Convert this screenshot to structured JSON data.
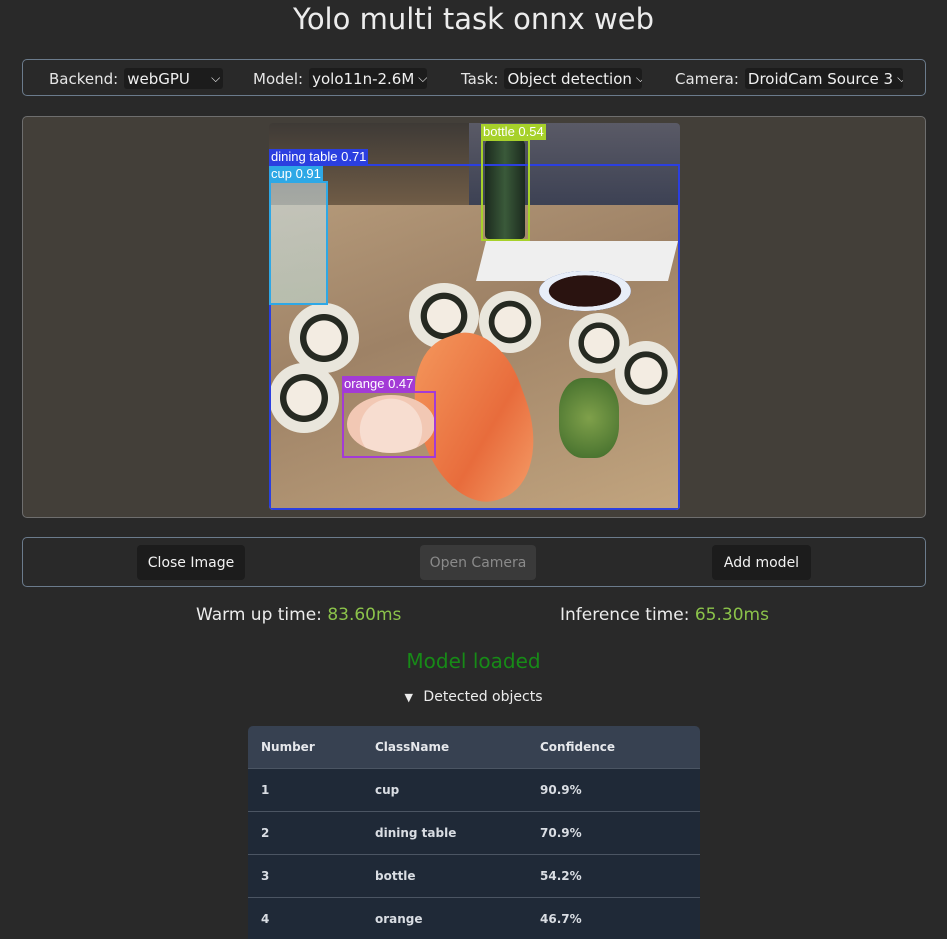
{
  "page": {
    "title": "Yolo multi task onnx web"
  },
  "controls": {
    "backend": {
      "label": "Backend:",
      "value": "webGPU"
    },
    "model": {
      "label": "Model:",
      "value": "yolo11n-2.6M"
    },
    "task": {
      "label": "Task:",
      "value": "Object detection"
    },
    "camera": {
      "label": "Camera:",
      "value": "DroidCam Source 3"
    },
    "chevron_icon": "chevron-down-icon"
  },
  "detections": [
    {
      "label": "dining table 0.71",
      "color": "#2b3fe0"
    },
    {
      "label": "cup 0.91",
      "color": "#2ea8e6"
    },
    {
      "label": "bottle 0.54",
      "color": "#a7d12a"
    },
    {
      "label": "orange 0.47",
      "color": "#a33bd6"
    }
  ],
  "buttons": {
    "close_image": "Close Image",
    "open_camera": "Open Camera",
    "add_model": "Add model"
  },
  "timing": {
    "warmup_label": "Warm up time:",
    "warmup_value": "83.60ms",
    "inference_label": "Inference time:",
    "inference_value": "65.30ms",
    "value_color": "#8bc34a"
  },
  "status": {
    "text": "Model loaded",
    "color": "#178a17"
  },
  "detected_objects": {
    "summary": "Detected objects",
    "toggle_icon": "triangle-down-icon",
    "columns": [
      "Number",
      "ClassName",
      "Confidence"
    ],
    "rows": [
      [
        "1",
        "cup",
        "90.9%"
      ],
      [
        "2",
        "dining table",
        "70.9%"
      ],
      [
        "3",
        "bottle",
        "54.2%"
      ],
      [
        "4",
        "orange",
        "46.7%"
      ]
    ]
  }
}
